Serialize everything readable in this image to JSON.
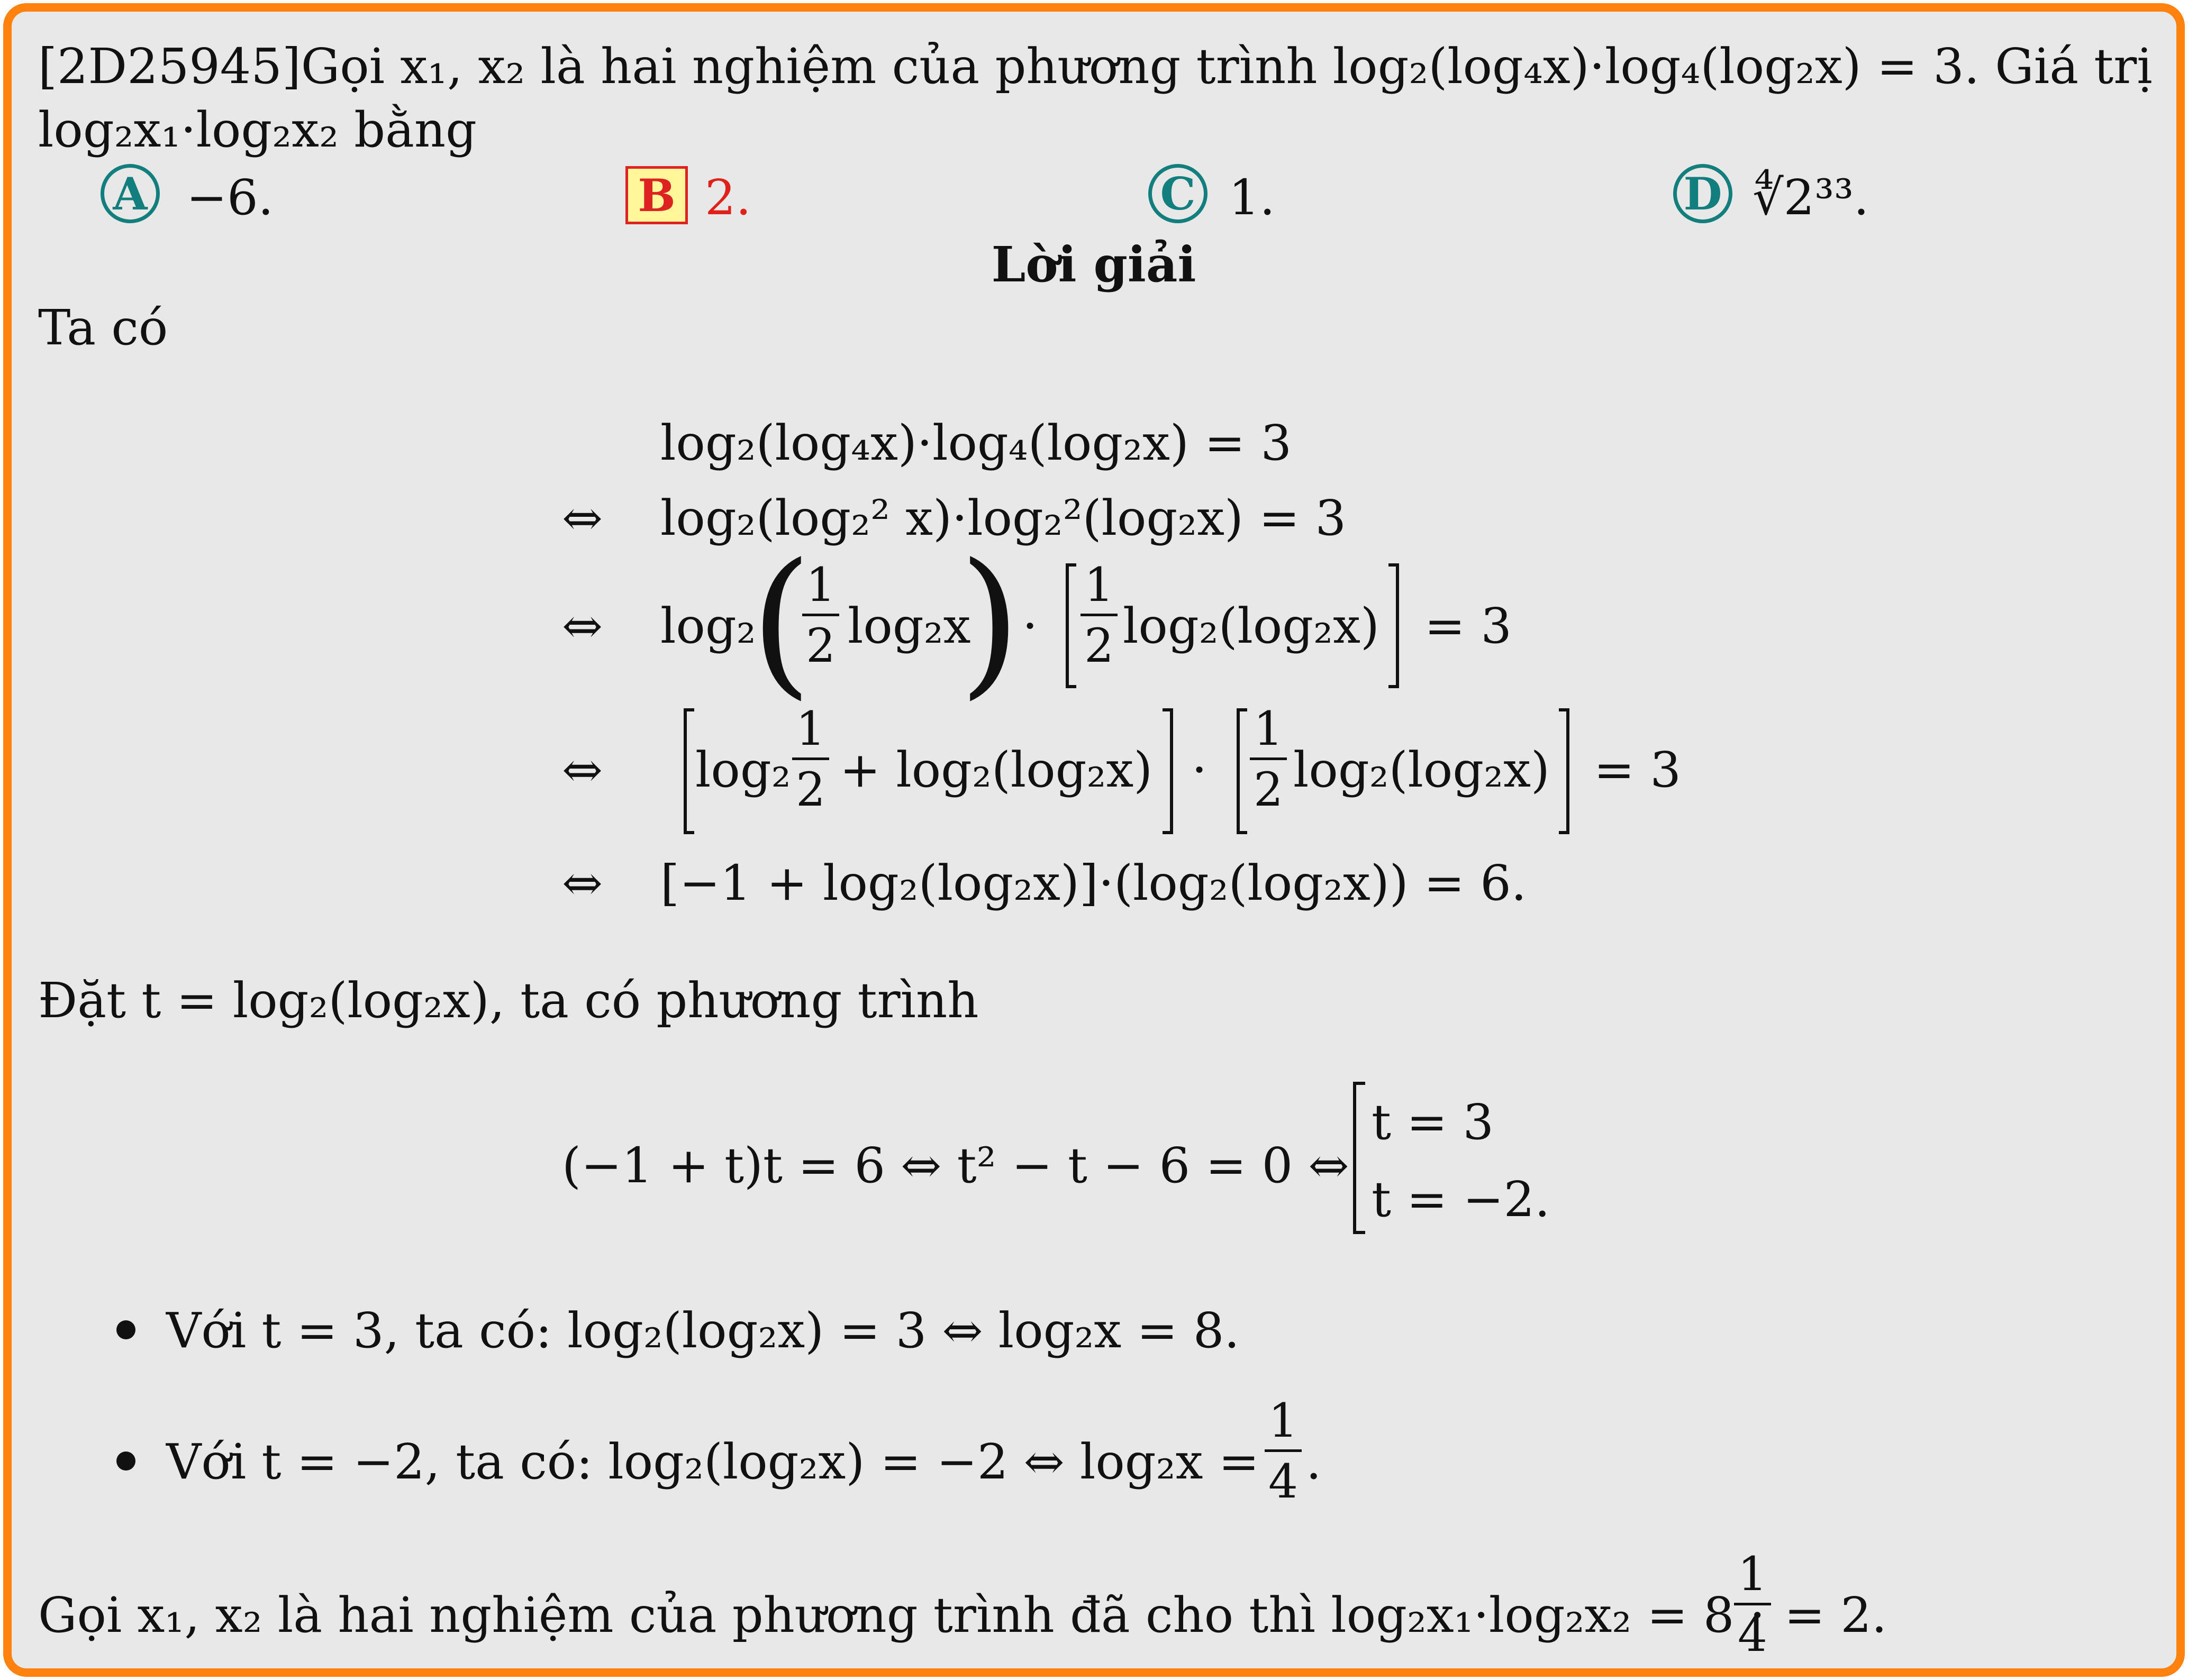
{
  "problem": {
    "statement_line1": "[2D25945]Gọi x₁, x₂ là hai nghiệm của phương trình log₂(log₄x)·log₄(log₂x) = 3. Giá trị",
    "statement_line2": "log₂x₁·log₂x₂ bằng"
  },
  "choices": [
    {
      "letter": "A",
      "text": "−6."
    },
    {
      "letter": "B",
      "text": "2.",
      "correct": true
    },
    {
      "letter": "C",
      "text": "1."
    },
    {
      "letter": "D",
      "text": "∜2³³."
    }
  ],
  "solution": {
    "heading": "Lời giải",
    "intro": "Ta có",
    "equiv_symbol": "⇔",
    "steps": {
      "s1": "log₂(log₄x)·log₄(log₂x) = 3",
      "s2": "log₂(log₂² x)·log₂²(log₂x) = 3",
      "s3_a": "log₂",
      "s3_b": "log₂x",
      "s3_c": "·",
      "s3_d": "log₂(log₂x)",
      "s3_e": "= 3",
      "s4_a": "log₂",
      "s4_b": "+ log₂(log₂x)",
      "s4_c": "·",
      "s4_d": "log₂(log₂x)",
      "s4_e": "= 3",
      "s5": "[−1 + log₂(log₂x)]·(log₂(log₂x)) = 6."
    },
    "frac_num": "1",
    "frac_den": "2",
    "substitution": "Đặt t = log₂(log₂x), ta có phương trình",
    "quadratic": "(−1 + t)t = 6 ⇔ t² − t − 6 = 0 ⇔",
    "root1": "t = 3",
    "root2": "t = −2.",
    "case1": "Với t = 3, ta có: log₂(log₂x) = 3 ⇔ log₂x = 8.",
    "case2_text": "Với t = −2, ta có: log₂(log₂x) = −2 ⇔ log₂x =",
    "case2_num": "1",
    "case2_den": "4",
    "case2_end": ".",
    "conclusion_text": "Gọi x₁, x₂ là hai nghiệm của phương trình đã cho thì log₂x₁·log₂x₂ = 8 ·",
    "conclusion_num": "1",
    "conclusion_den": "4",
    "conclusion_end": "= 2."
  },
  "colors": {
    "frame": "#ff820f",
    "panel": "#e8e8e8",
    "choice_circle": "#127e7e",
    "correct_answer": "#e0201a",
    "correct_box": "#fff79a"
  }
}
